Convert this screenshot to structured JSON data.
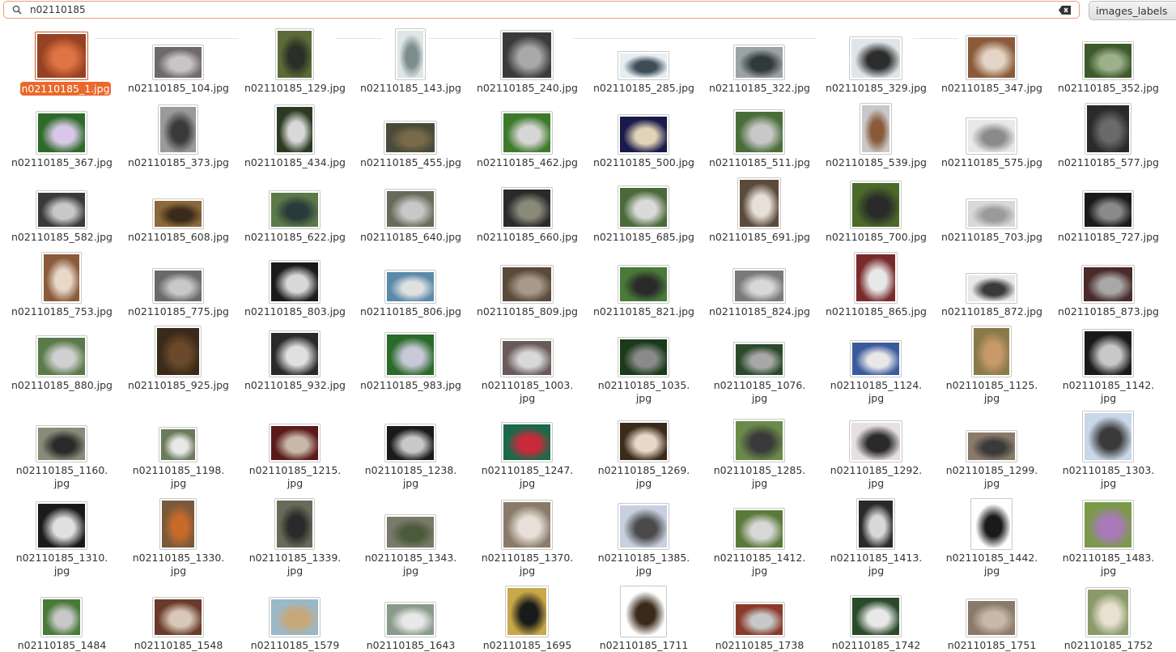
{
  "search": {
    "query": "n02110185"
  },
  "tag_button": {
    "label": "images_labels"
  },
  "colors": {
    "accent": "#e9692c",
    "border": "#e9a07a"
  },
  "files": [
    {
      "name": "n02110185_1.jpg",
      "selected": true
    },
    {
      "name": "n02110185_104.jpg"
    },
    {
      "name": "n02110185_129.jpg"
    },
    {
      "name": "n02110185_143.jpg"
    },
    {
      "name": "n02110185_240.jpg"
    },
    {
      "name": "n02110185_285.jpg"
    },
    {
      "name": "n02110185_322.jpg"
    },
    {
      "name": "n02110185_329.jpg"
    },
    {
      "name": "n02110185_347.jpg"
    },
    {
      "name": "n02110185_352.jpg"
    },
    {
      "name": "n02110185_367.jpg"
    },
    {
      "name": "n02110185_373.jpg"
    },
    {
      "name": "n02110185_434.jpg"
    },
    {
      "name": "n02110185_455.jpg"
    },
    {
      "name": "n02110185_462.jpg"
    },
    {
      "name": "n02110185_500.jpg"
    },
    {
      "name": "n02110185_511.jpg"
    },
    {
      "name": "n02110185_539.jpg"
    },
    {
      "name": "n02110185_575.jpg"
    },
    {
      "name": "n02110185_577.jpg"
    },
    {
      "name": "n02110185_582.jpg"
    },
    {
      "name": "n02110185_608.jpg"
    },
    {
      "name": "n02110185_622.jpg"
    },
    {
      "name": "n02110185_640.jpg"
    },
    {
      "name": "n02110185_660.jpg"
    },
    {
      "name": "n02110185_685.jpg"
    },
    {
      "name": "n02110185_691.jpg"
    },
    {
      "name": "n02110185_700.jpg"
    },
    {
      "name": "n02110185_703.jpg"
    },
    {
      "name": "n02110185_727.jpg"
    },
    {
      "name": "n02110185_753.jpg"
    },
    {
      "name": "n02110185_775.jpg"
    },
    {
      "name": "n02110185_803.jpg"
    },
    {
      "name": "n02110185_806.jpg"
    },
    {
      "name": "n02110185_809.jpg"
    },
    {
      "name": "n02110185_821.jpg"
    },
    {
      "name": "n02110185_824.jpg"
    },
    {
      "name": "n02110185_865.jpg"
    },
    {
      "name": "n02110185_872.jpg"
    },
    {
      "name": "n02110185_873.jpg"
    },
    {
      "name": "n02110185_880.jpg"
    },
    {
      "name": "n02110185_925.jpg"
    },
    {
      "name": "n02110185_932.jpg"
    },
    {
      "name": "n02110185_983.jpg"
    },
    {
      "name": "n02110185_1003.\njpg"
    },
    {
      "name": "n02110185_1035.\njpg"
    },
    {
      "name": "n02110185_1076.\njpg"
    },
    {
      "name": "n02110185_1124.\njpg"
    },
    {
      "name": "n02110185_1125.\njpg"
    },
    {
      "name": "n02110185_1142.\njpg"
    },
    {
      "name": "n02110185_1160.\njpg"
    },
    {
      "name": "n02110185_1198.\njpg"
    },
    {
      "name": "n02110185_1215.\njpg"
    },
    {
      "name": "n02110185_1238.\njpg"
    },
    {
      "name": "n02110185_1247.\njpg"
    },
    {
      "name": "n02110185_1269.\njpg"
    },
    {
      "name": "n02110185_1285.\njpg"
    },
    {
      "name": "n02110185_1292.\njpg"
    },
    {
      "name": "n02110185_1299.\njpg"
    },
    {
      "name": "n02110185_1303.\njpg"
    },
    {
      "name": "n02110185_1310.\njpg"
    },
    {
      "name": "n02110185_1330.\njpg"
    },
    {
      "name": "n02110185_1339.\njpg"
    },
    {
      "name": "n02110185_1343.\njpg"
    },
    {
      "name": "n02110185_1370.\njpg"
    },
    {
      "name": "n02110185_1385.\njpg"
    },
    {
      "name": "n02110185_1412.\njpg"
    },
    {
      "name": "n02110185_1413.\njpg"
    },
    {
      "name": "n02110185_1442.\njpg"
    },
    {
      "name": "n02110185_1483.\njpg"
    },
    {
      "name": "n02110185_1484"
    },
    {
      "name": "n02110185_1548"
    },
    {
      "name": "n02110185_1579"
    },
    {
      "name": "n02110185_1643"
    },
    {
      "name": "n02110185_1695"
    },
    {
      "name": "n02110185_1711"
    },
    {
      "name": "n02110185_1738"
    },
    {
      "name": "n02110185_1742"
    },
    {
      "name": "n02110185_1751"
    },
    {
      "name": "n02110185_1752"
    }
  ]
}
